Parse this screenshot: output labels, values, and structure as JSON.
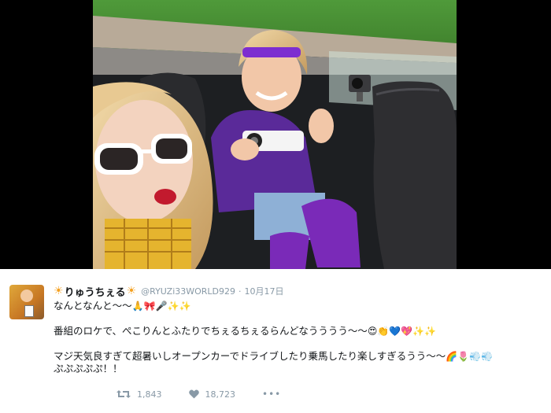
{
  "tweet": {
    "display_name": "りゅうちぇる",
    "name_prefix_emoji": "☀",
    "name_suffix_emoji": "☀",
    "handle": "@RYUZi33WORLD929",
    "separator": "·",
    "timestamp": "10月17日",
    "lines": [
      {
        "text": "なんとなんと〜〜",
        "emojis": [
          "🙏",
          "🎀",
          "🎤",
          "✨",
          "✨"
        ]
      },
      {
        "text": "番組のロケで、ぺこりんとふたりでちぇるちぇるらんどなうううう〜〜",
        "emojis": [
          "😍",
          "👏",
          "💙",
          "💖",
          "✨",
          "✨"
        ]
      },
      {
        "text": "マジ天気良すぎて超暑いしオープンカーでドライブしたり乗馬したり楽しすぎるうう〜〜",
        "emojis": [
          "🌈",
          "🌷",
          "💨",
          "💨"
        ]
      },
      {
        "text": "ぷぷぷぷぷ！！",
        "emojis": []
      }
    ],
    "retweet_count": "1,843",
    "like_count": "18,723",
    "more_label": "•••"
  },
  "icons": {
    "retweet": "retweet-icon",
    "like": "heart-icon",
    "more": "more-icon"
  },
  "colors": {
    "text": "#14171a",
    "muted": "#8899a6",
    "sun": "#f4a020",
    "background": "#ffffff",
    "letterbox": "#000000"
  }
}
